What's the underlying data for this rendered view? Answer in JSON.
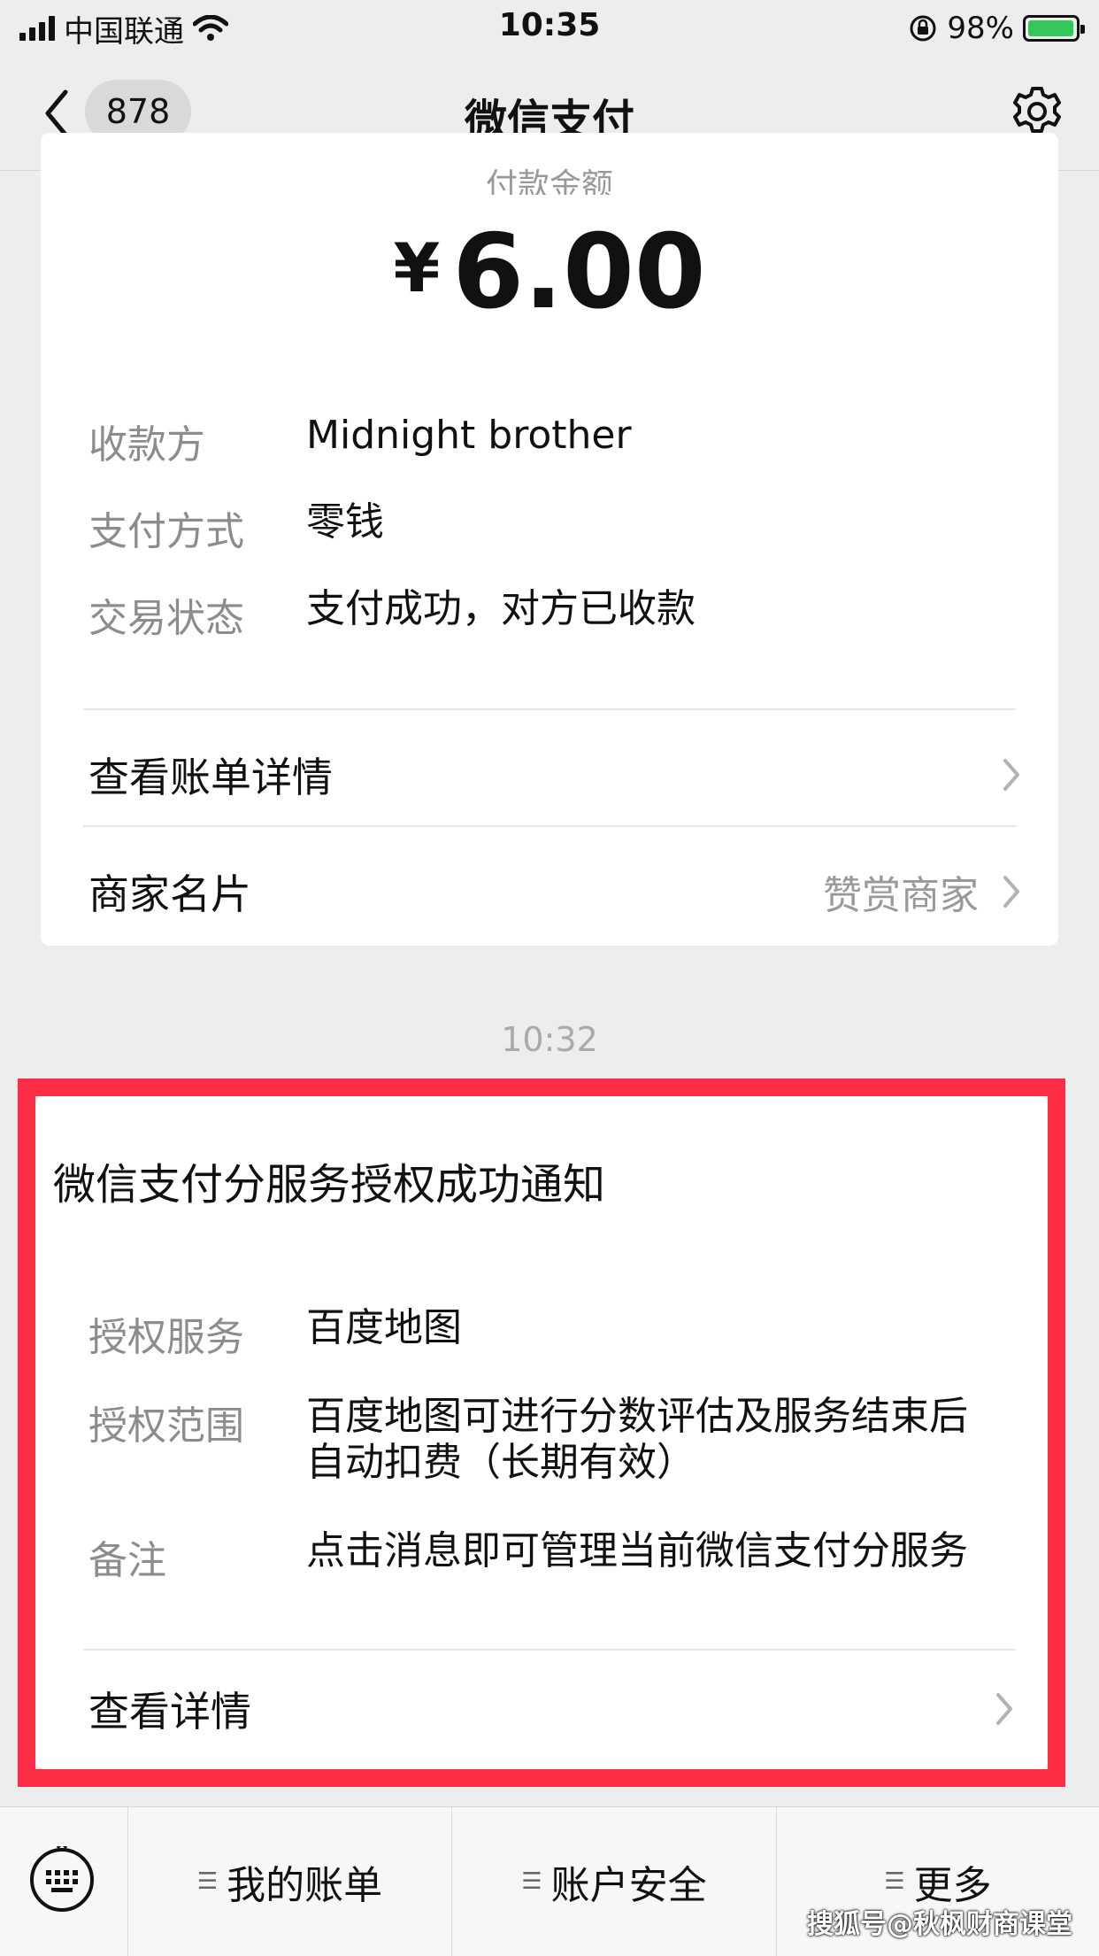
{
  "status_bar": {
    "carrier": "中国联通",
    "time": "10:35",
    "battery": "98%",
    "battery_level": 0.98
  },
  "nav": {
    "back_badge": "878",
    "title": "微信支付"
  },
  "payment": {
    "amount_label": "付款金额",
    "currency": "¥",
    "amount": "6.00",
    "fields": [
      {
        "label": "收款方",
        "value": "Midnight brother"
      },
      {
        "label": "支付方式",
        "value": "零钱"
      },
      {
        "label": "交易状态",
        "value": "支付成功，对方已收款"
      }
    ],
    "bill_detail": "查看账单详情",
    "merchant_card": "商家名片",
    "tip_merchant": "赞赏商家"
  },
  "message_time": "10:32",
  "notice": {
    "title": "微信支付分服务授权成功通知",
    "fields": [
      {
        "label": "授权服务",
        "value": "百度地图"
      },
      {
        "label": "授权范围",
        "value": "百度地图可进行分数评估及服务结束后\n自动扣费（长期有效）"
      },
      {
        "label": "备注",
        "value": "点击消息即可管理当前微信支付分服务"
      }
    ],
    "view_detail": "查看详情"
  },
  "bottom_menu": [
    "我的账单",
    "账户安全",
    "更多"
  ],
  "watermark": "搜狐号@秋枫财商课堂",
  "colors": {
    "background": "#ededed",
    "highlight": "#ff2d46",
    "battery": "#35c759"
  }
}
